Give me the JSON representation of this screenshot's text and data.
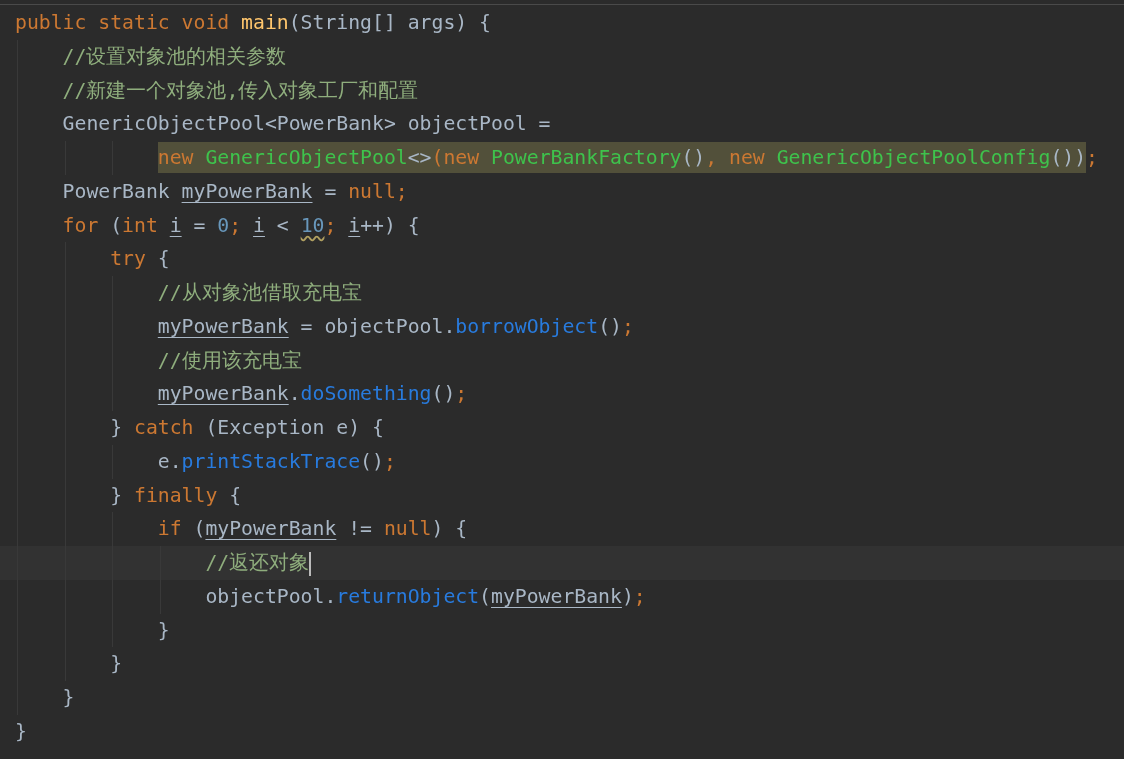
{
  "editor": {
    "lines": [
      {
        "kind": "statement",
        "current": false,
        "tokens": [
          {
            "text": "public static void ",
            "kind": "keyword"
          },
          {
            "text": "main",
            "kind": "declaration"
          },
          {
            "text": "(String[] args) {",
            "kind": "plain"
          }
        ],
        "children": [
          {
            "kind": "statement",
            "current": false,
            "tokens": [
              {
                "text": "//设置对象池的相关参数",
                "kind": "comment"
              }
            ]
          },
          {
            "kind": "statement",
            "current": false,
            "tokens": [
              {
                "text": "//新建一个对象池,传入对象工厂和配置",
                "kind": "comment"
              }
            ]
          },
          {
            "kind": "statement",
            "current": false,
            "tokens": [
              {
                "text": "GenericObjectPool<PowerBank> objectPool =",
                "kind": "plain"
              }
            ],
            "children": [
              {
                "kind": "continuation",
                "current": false,
                "tokens": [
                  {
                    "text": "new ",
                    "kind": "keyword",
                    "highlight": true
                  },
                  {
                    "text": "GenericObjectPool",
                    "kind": "match",
                    "highlight": true
                  },
                  {
                    "text": "<>",
                    "kind": "plain",
                    "highlight": true
                  },
                  {
                    "text": "(",
                    "kind": "keyword",
                    "highlight": true
                  },
                  {
                    "text": "new ",
                    "kind": "keyword",
                    "highlight": true
                  },
                  {
                    "text": "PowerBankFactory",
                    "kind": "match",
                    "highlight": true
                  },
                  {
                    "text": "()",
                    "kind": "plain",
                    "highlight": true
                  },
                  {
                    "text": ", new ",
                    "kind": "keyword",
                    "highlight": true
                  },
                  {
                    "text": "GenericObjectPoolConfig",
                    "kind": "match",
                    "highlight": true
                  },
                  {
                    "text": "())",
                    "kind": "plain",
                    "highlight": true
                  },
                  {
                    "text": ";",
                    "kind": "keyword",
                    "highlight": false
                  }
                ]
              }
            ]
          },
          {
            "kind": "statement",
            "current": false,
            "tokens": [
              {
                "text": "PowerBank ",
                "kind": "plain"
              },
              {
                "text": "myPowerBank",
                "kind": "variable"
              },
              {
                "text": " = ",
                "kind": "plain"
              },
              {
                "text": "null;",
                "kind": "keyword"
              }
            ]
          },
          {
            "kind": "statement",
            "current": false,
            "tokens": [
              {
                "text": "for ",
                "kind": "keyword"
              },
              {
                "text": "(",
                "kind": "plain"
              },
              {
                "text": "int ",
                "kind": "keyword"
              },
              {
                "text": "i",
                "kind": "variable"
              },
              {
                "text": " = ",
                "kind": "plain"
              },
              {
                "text": "0",
                "kind": "number"
              },
              {
                "text": "; ",
                "kind": "keyword"
              },
              {
                "text": "i",
                "kind": "variable"
              },
              {
                "text": " < ",
                "kind": "plain"
              },
              {
                "text": "10",
                "kind": "warning"
              },
              {
                "text": "; ",
                "kind": "keyword"
              },
              {
                "text": "i",
                "kind": "variable"
              },
              {
                "text": "++) {",
                "kind": "plain"
              }
            ],
            "children": [
              {
                "kind": "statement",
                "current": false,
                "tokens": [
                  {
                    "text": "try ",
                    "kind": "keyword"
                  },
                  {
                    "text": "{",
                    "kind": "plain"
                  }
                ],
                "children": [
                  {
                    "kind": "statement",
                    "current": false,
                    "tokens": [
                      {
                        "text": "//从对象池借取充电宝",
                        "kind": "comment"
                      }
                    ]
                  },
                  {
                    "kind": "statement",
                    "current": false,
                    "tokens": [
                      {
                        "text": "myPowerBank",
                        "kind": "variable"
                      },
                      {
                        "text": " = objectPool.",
                        "kind": "plain"
                      },
                      {
                        "text": "borrowObject",
                        "kind": "call"
                      },
                      {
                        "text": "()",
                        "kind": "plain"
                      },
                      {
                        "text": ";",
                        "kind": "keyword"
                      }
                    ]
                  },
                  {
                    "kind": "statement",
                    "current": false,
                    "tokens": [
                      {
                        "text": "//使用该充电宝",
                        "kind": "comment"
                      }
                    ]
                  },
                  {
                    "kind": "statement",
                    "current": false,
                    "tokens": [
                      {
                        "text": "myPowerBank",
                        "kind": "variable"
                      },
                      {
                        "text": ".",
                        "kind": "plain"
                      },
                      {
                        "text": "doSomething",
                        "kind": "call"
                      },
                      {
                        "text": "()",
                        "kind": "plain"
                      },
                      {
                        "text": ";",
                        "kind": "keyword"
                      }
                    ]
                  }
                ]
              },
              {
                "kind": "statement",
                "current": false,
                "tokens": [
                  {
                    "text": "} ",
                    "kind": "plain"
                  },
                  {
                    "text": "catch ",
                    "kind": "keyword"
                  },
                  {
                    "text": "(Exception e) {",
                    "kind": "plain"
                  }
                ],
                "children": [
                  {
                    "kind": "statement",
                    "current": false,
                    "tokens": [
                      {
                        "text": "e.",
                        "kind": "plain"
                      },
                      {
                        "text": "printStackTrace",
                        "kind": "call"
                      },
                      {
                        "text": "()",
                        "kind": "plain"
                      },
                      {
                        "text": ";",
                        "kind": "keyword"
                      }
                    ]
                  }
                ]
              },
              {
                "kind": "statement",
                "current": false,
                "tokens": [
                  {
                    "text": "} ",
                    "kind": "plain"
                  },
                  {
                    "text": "finally ",
                    "kind": "keyword"
                  },
                  {
                    "text": "{",
                    "kind": "plain"
                  }
                ],
                "children": [
                  {
                    "kind": "statement",
                    "current": false,
                    "tokens": [
                      {
                        "text": "if ",
                        "kind": "keyword"
                      },
                      {
                        "text": "(",
                        "kind": "plain"
                      },
                      {
                        "text": "myPowerBank",
                        "kind": "variable"
                      },
                      {
                        "text": " != ",
                        "kind": "plain"
                      },
                      {
                        "text": "null",
                        "kind": "keyword"
                      },
                      {
                        "text": ") {",
                        "kind": "plain"
                      }
                    ],
                    "children": [
                      {
                        "kind": "statement",
                        "current": true,
                        "tokens": [
                          {
                            "text": "//返还对象",
                            "kind": "comment"
                          }
                        ]
                      },
                      {
                        "kind": "statement",
                        "current": false,
                        "tokens": [
                          {
                            "text": "objectPool.",
                            "kind": "plain"
                          },
                          {
                            "text": "returnObject",
                            "kind": "call"
                          },
                          {
                            "text": "(",
                            "kind": "plain"
                          },
                          {
                            "text": "myPowerBank",
                            "kind": "variable"
                          },
                          {
                            "text": ")",
                            "kind": "plain"
                          },
                          {
                            "text": ";",
                            "kind": "keyword"
                          }
                        ]
                      }
                    ]
                  },
                  {
                    "kind": "statement",
                    "current": false,
                    "tokens": [
                      {
                        "text": "}",
                        "kind": "plain"
                      }
                    ]
                  }
                ]
              },
              {
                "kind": "statement",
                "current": false,
                "tokens": [
                  {
                    "text": "}",
                    "kind": "plain"
                  }
                ]
              }
            ]
          },
          {
            "kind": "statement",
            "current": false,
            "tokens": [
              {
                "text": "}",
                "kind": "plain"
              }
            ]
          }
        ]
      },
      {
        "kind": "statement",
        "current": false,
        "tokens": [
          {
            "text": "}",
            "kind": "plain"
          }
        ]
      }
    ]
  }
}
